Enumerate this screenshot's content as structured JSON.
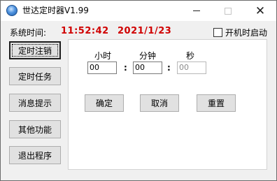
{
  "window": {
    "title": "世达定时器V1.99",
    "controls": {
      "minimize_icon": "minimize-icon",
      "maximize_icon": "maximize-icon",
      "close_icon": "close-icon",
      "close_glyph": "✕"
    }
  },
  "status": {
    "system_time_label": "系统时间:",
    "time": "11:52:42",
    "date": "2021/1/23",
    "time_color": "#d00000",
    "autostart_label": "开机时启动",
    "autostart_checked": false
  },
  "sidebar": {
    "items": [
      {
        "label": "定时注销",
        "active": true
      },
      {
        "label": "定时任务",
        "active": false
      },
      {
        "label": "消息提示",
        "active": false
      },
      {
        "label": "其他功能",
        "active": false
      },
      {
        "label": "退出程序",
        "active": false
      }
    ]
  },
  "panel": {
    "labels": {
      "hour": "小时",
      "minute": "分钟",
      "second": "秒"
    },
    "fields": {
      "hour": "00",
      "minute": "00",
      "second": "00"
    },
    "separator": ":",
    "buttons": {
      "confirm": "确定",
      "cancel": "取消",
      "reset": "重置"
    }
  }
}
